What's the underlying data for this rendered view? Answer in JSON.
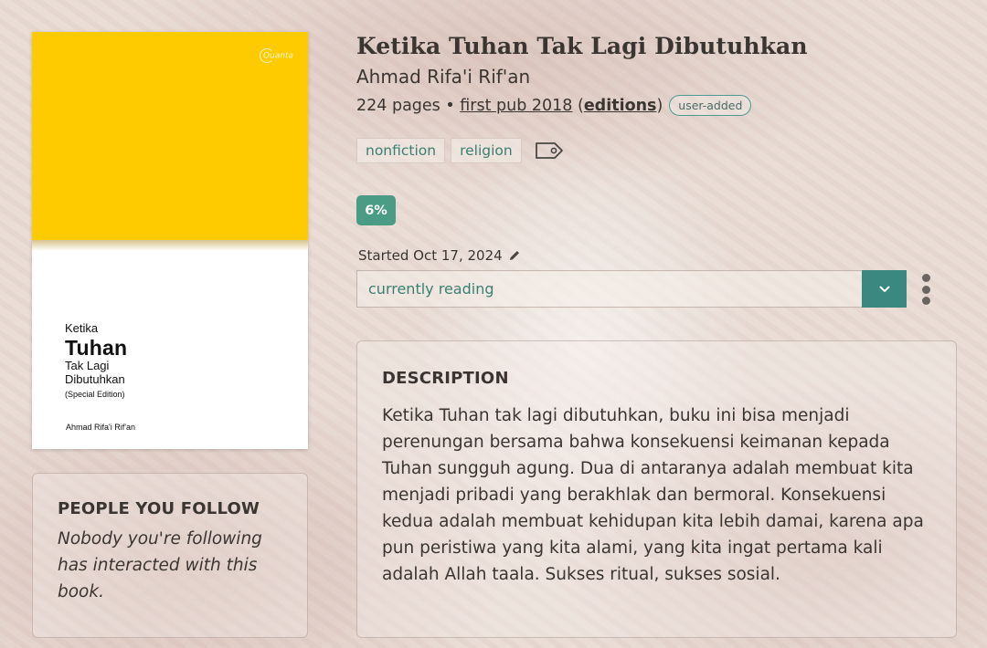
{
  "cover": {
    "publisher": "Quanta",
    "title_line1": "Ketika",
    "title_line2": "Tuhan",
    "title_line3": "Tak Lagi",
    "title_line4": "Dibutuhkan",
    "edition": "(Special Edition)",
    "author": "Ahmad Rifa'i Rif'an"
  },
  "book": {
    "title": "Ketika Tuhan Tak Lagi Dibutuhkan",
    "author": "Ahmad Rifa'i Rif'an",
    "pages": "224 pages",
    "separator": " • ",
    "first_pub": "first pub 2018",
    "open_paren": " (",
    "editions": "editions",
    "close_paren": ")",
    "user_added": "user-added"
  },
  "tags": [
    "nonfiction",
    "religion"
  ],
  "progress": {
    "label": "6%",
    "percent": 6
  },
  "started": "Started Oct 17, 2024",
  "status": {
    "value": "currently reading"
  },
  "follow": {
    "title": "PEOPLE YOU FOLLOW",
    "text": "Nobody you're following has interacted with this book."
  },
  "description": {
    "title": "DESCRIPTION",
    "text": "Ketika Tuhan tak lagi dibutuhkan, buku ini bisa menjadi perenungan bersama bahwa konsekuensi keimanan kepada Tuhan sungguh agung. Dua di antaranya adalah membuat kita menjadi pribadi yang berakhlak dan bermoral. Konsekuensi kedua adalah membuat kehidupan kita lebih damai, karena apa pun peristiwa yang kita alami, yang kita ingat pertama kali adalah Allah taala. Sukses ritual, sukses sosial."
  },
  "colors": {
    "accent": "#3a8880",
    "progress": "#4a9c84",
    "tag_text": "#3b7f74",
    "cover_yellow": "#fecb00"
  }
}
